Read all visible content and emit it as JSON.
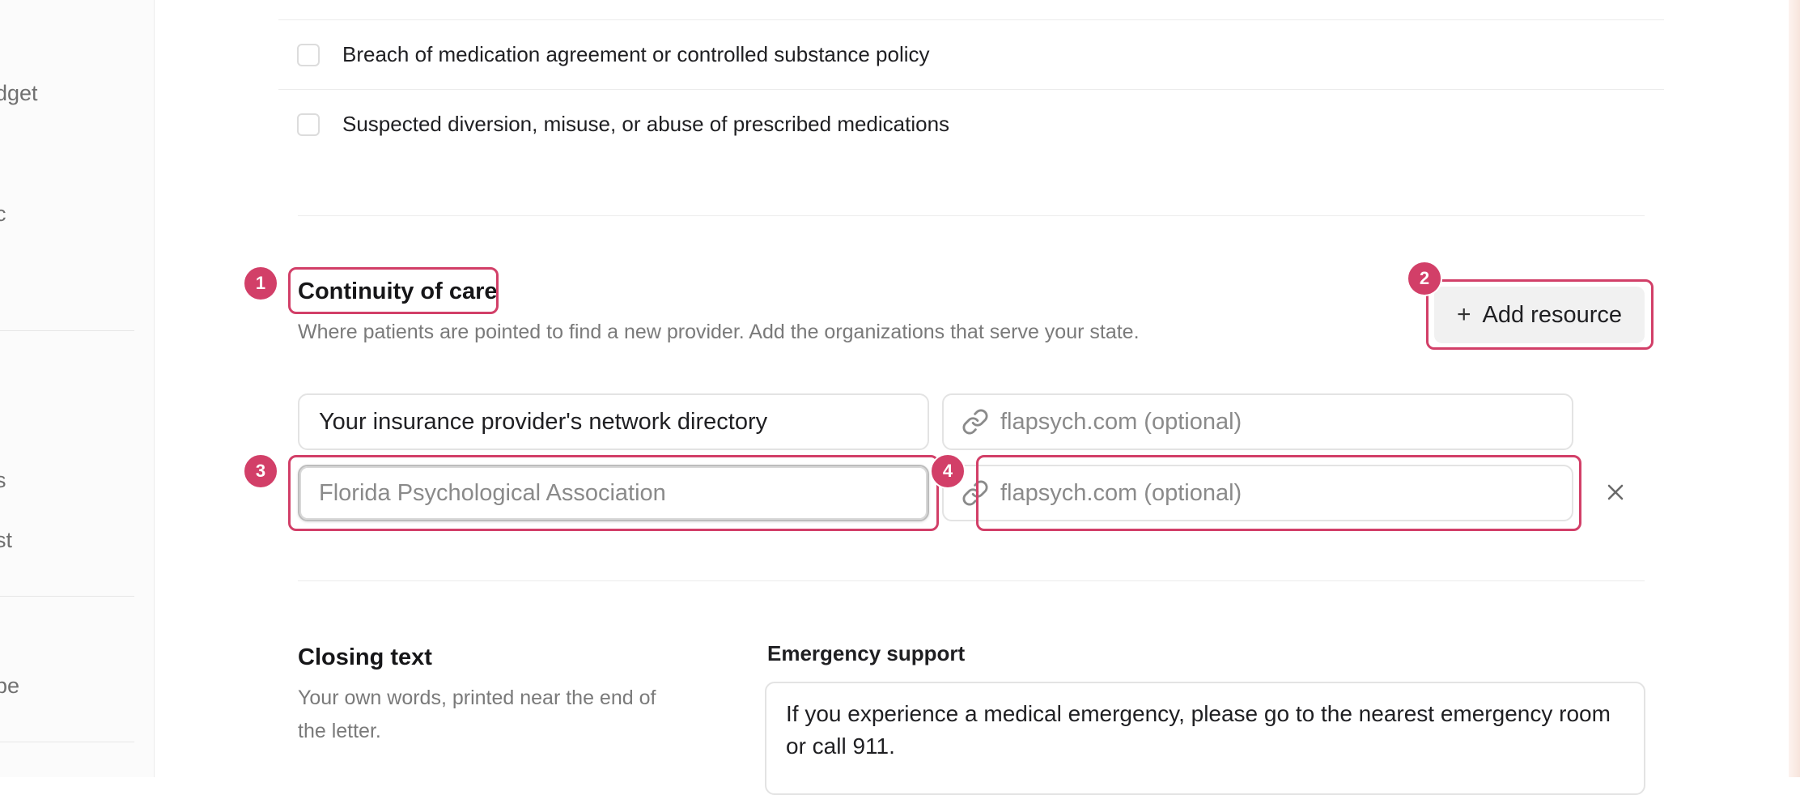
{
  "sidebar": {
    "items": [
      "dget",
      "c",
      "s",
      "st",
      "pe"
    ]
  },
  "conditions": [
    "Breach of medication agreement or controlled substance policy",
    "Suspected diversion, misuse, or abuse of prescribed medications"
  ],
  "continuity": {
    "title": "Continuity of care",
    "description": "Where patients are pointed to find a new provider. Add the organizations that serve your state.",
    "add_button": "Add resource",
    "resources": [
      {
        "name_value": "Your insurance provider's network directory",
        "url_placeholder": "flapsych.com (optional)"
      },
      {
        "name_placeholder": "Florida Psychological Association",
        "url_placeholder": "flapsych.com (optional)"
      }
    ]
  },
  "closing": {
    "title": "Closing text",
    "description": "Your own words, printed near the end of the letter.",
    "emergency_label": "Emergency support",
    "emergency_text": "If you experience a medical emergency, please go to the nearest emergency room or call 911."
  },
  "annotations": [
    "1",
    "2",
    "3",
    "4"
  ],
  "colors": {
    "accent": "#d23f68",
    "button_bg": "#f1f1f1"
  }
}
